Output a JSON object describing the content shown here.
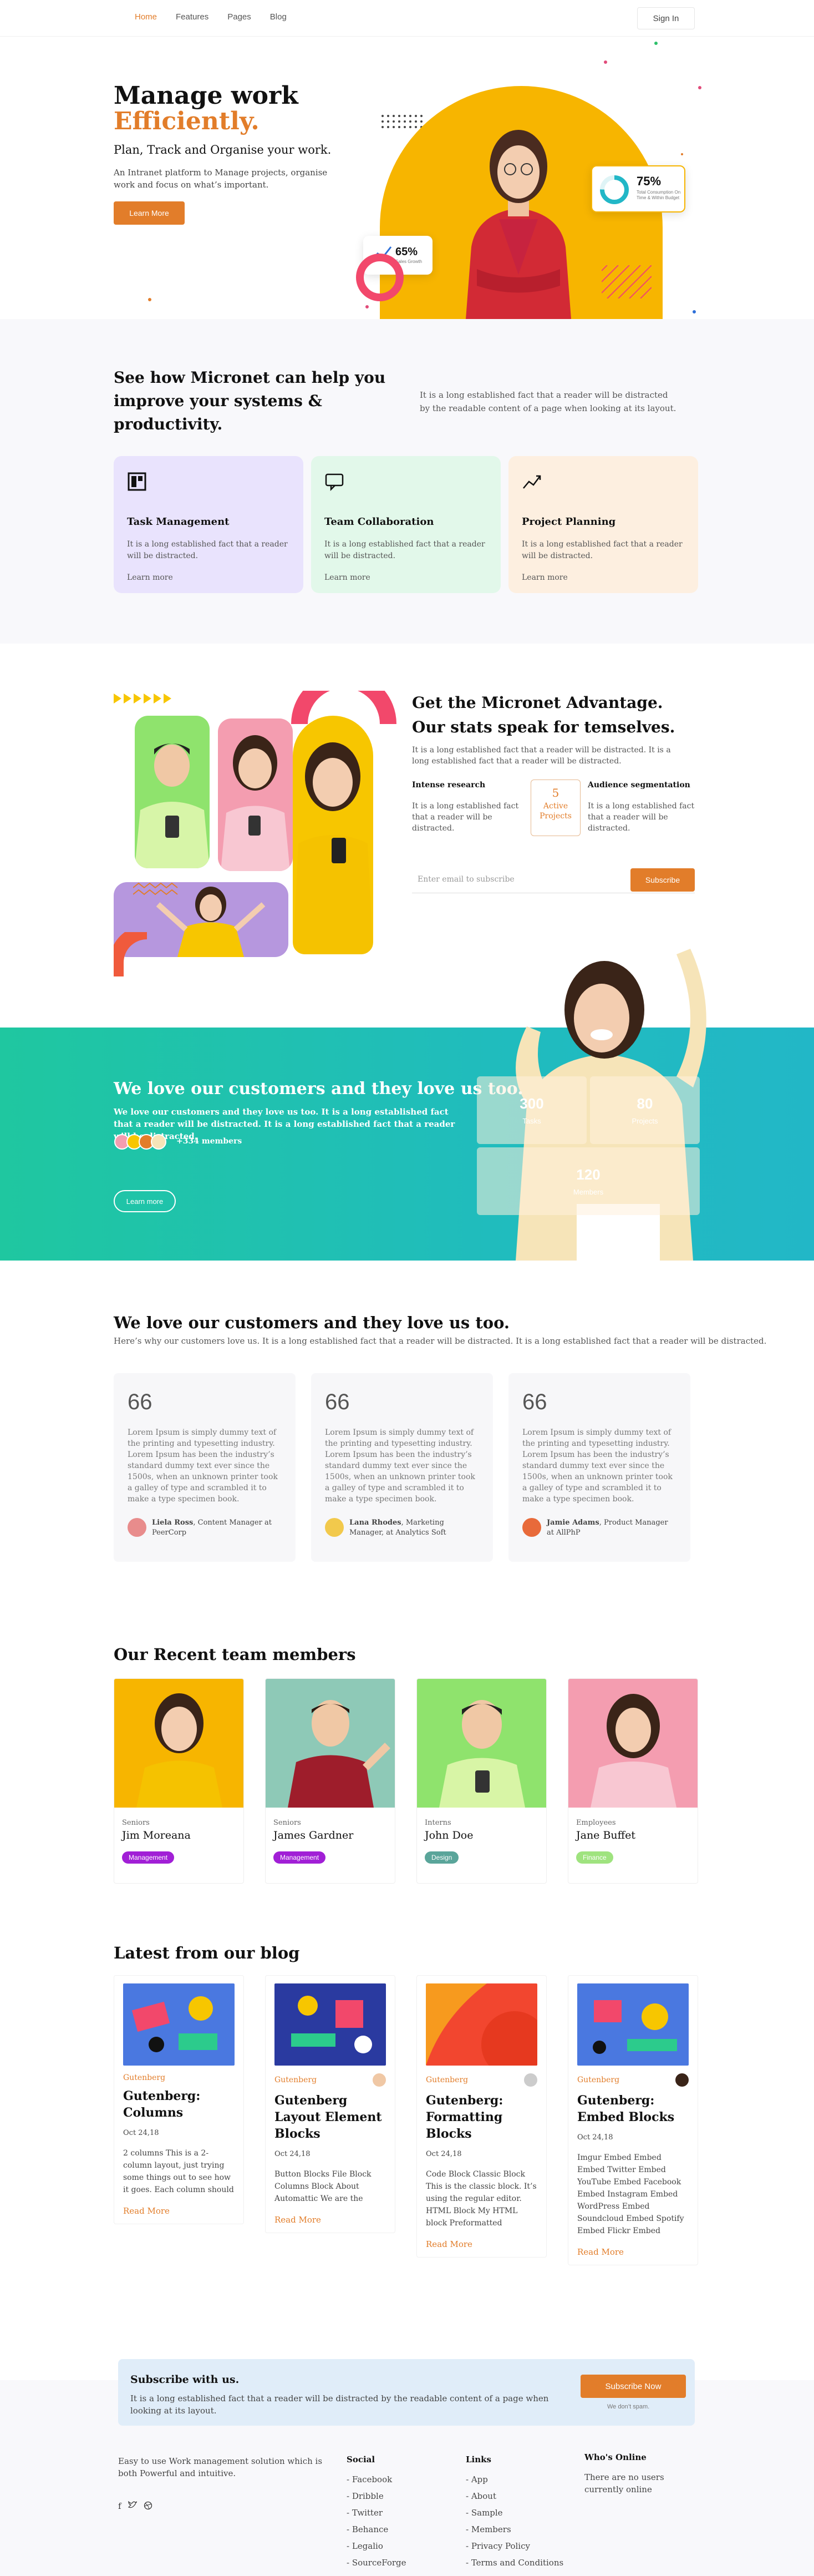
{
  "nav": {
    "items": [
      "Home",
      "Features",
      "Pages",
      "Blog"
    ],
    "signin": "Sign In"
  },
  "hero": {
    "title_line1": "Manage work",
    "title_line2": "Efficiently.",
    "subtitle": "Plan, Track and Organise your work.",
    "description": "An Intranet platform to Manage projects, organise work and focus on what’s important.",
    "button": "Learn More",
    "stat_left": "65%",
    "stat_left_caption": "Sales Growth",
    "stat_right": "75%",
    "stat_right_caption": "Total Consumption On Time & Within Budget"
  },
  "features_section": {
    "title": "See how Micronet can help you improve your systems & productivity.",
    "description": "It is a long established fact that a reader will be distracted by the readable content of a page when looking at its layout.",
    "cards": [
      {
        "title": "Task Management",
        "text": "It is a long established fact that a reader will be distracted.",
        "link": "Learn more",
        "color": "#e9e3fd",
        "icon": "layout-icon"
      },
      {
        "title": "Team Collaboration",
        "text": "It is a long established fact that a reader will be distracted.",
        "link": "Learn more",
        "color": "#e2f8ea",
        "icon": "chat-icon"
      },
      {
        "title": "Project Planning",
        "text": "It is a long established fact that a reader will be distracted.",
        "link": "Learn more",
        "color": "#fdefe0",
        "icon": "chart-line-icon"
      }
    ]
  },
  "advantage": {
    "title": "Get the Micronet Advantage. Our stats speak for temselves.",
    "description": "It is a long established fact that a reader will be distracted. It is a long established fact that a reader will be distracted.",
    "col1_title": "Intense research",
    "col1_text": "It is a long established fact that a reader will be distracted.",
    "active_number": "5",
    "active_label": "Active Projects",
    "col2_title": "Audience segmentation",
    "col2_text": "It is a long established fact that a reader will be distracted.",
    "email_placeholder": "Enter email to subscribe",
    "subscribe": "Subscribe"
  },
  "customers_banner": {
    "title": "We love our customers and they love us too.",
    "description": "We love our customers and they love us too. It is a long established fact that a reader will be distracted. It is a long established fact that a reader will be distracted.",
    "members": "+334 members",
    "button": "Learn more",
    "stats": [
      {
        "number": "300",
        "label": "Tasks"
      },
      {
        "number": "80",
        "label": "Projects"
      },
      {
        "number": "120",
        "label": "Members"
      }
    ]
  },
  "testimonials": {
    "title": "We love our customers and they love us too.",
    "description": "Here’s why our customers love us. It is a long established fact that a reader will be distracted. It is a long established fact that a reader will be distracted.",
    "quote_mark": "66",
    "items": [
      {
        "text": "Lorem Ipsum is simply dummy text of the printing and typesetting industry. Lorem Ipsum has been the industry’s standard dummy text ever since the 1500s, when an unknown printer took a galley of type and scrambled it to make a type specimen book.",
        "name": "Liela Ross",
        "role": ", Content Manager at PeerCorp",
        "avatar": "#e88c8c"
      },
      {
        "text": "Lorem Ipsum is simply dummy text of the printing and typesetting industry. Lorem Ipsum has been the industry’s standard dummy text ever since the 1500s, when an unknown printer took a galley of type and scrambled it to make a type specimen book.",
        "name": "Lana Rhodes",
        "role": ", Marketing Manager, at Analytics Soft",
        "avatar": "#f2c94c"
      },
      {
        "text": "Lorem Ipsum is simply dummy text of the printing and typesetting industry. Lorem Ipsum has been the industry’s standard dummy text ever since the 1500s, when an unknown printer took a galley of type and scrambled it to make a type specimen book.",
        "name": "Jamie Adams",
        "role": ", Product Manager at AllPhP",
        "avatar": "#e86a3a"
      }
    ]
  },
  "team": {
    "title": "Our Recent team members",
    "members": [
      {
        "role": "Seniors",
        "name": "Jim Moreana",
        "tag": "Management",
        "tag_color": "#a11fd6",
        "bg": "#f7b500",
        "shirt": "#f5c200"
      },
      {
        "role": "Seniors",
        "name": "James Gardner",
        "tag": "Management",
        "tag_color": "#a11fd6",
        "bg": "#8ec9b7",
        "shirt": "#9e1d2b"
      },
      {
        "role": "Interns",
        "name": "John Doe",
        "tag": "Design",
        "tag_color": "#5aa59a",
        "bg": "#8fe36d",
        "shirt": "#d8f5a6"
      },
      {
        "role": "Employees",
        "name": "Jane Buffet",
        "tag": "Finance",
        "tag_color": "#9fe37f",
        "bg": "#f49db0",
        "shirt": "#f8c7d2"
      }
    ]
  },
  "blog": {
    "title": "Latest from our blog",
    "posts": [
      {
        "category": "Gutenberg",
        "title": "Gutenberg: Columns",
        "date": "Oct 24,18",
        "excerpt": "2 columns This is a 2-column layout, just trying some things out to see how it goes. Each column should",
        "link": "Read More"
      },
      {
        "category": "Gutenberg",
        "title": "Gutenberg Layout Element Blocks",
        "date": "Oct 24,18",
        "excerpt": "Button Blocks File Block Columns Block About Automattic We are the",
        "link": "Read More"
      },
      {
        "category": "Gutenberg",
        "title": "Gutenberg: Formatting Blocks",
        "date": "Oct 24,18",
        "excerpt": "Code Block Classic Block This is the classic block. It’s using the regular editor. HTML Block My HTML block Preformatted",
        "link": "Read More"
      },
      {
        "category": "Gutenberg",
        "title": "Gutenberg: Embed Blocks",
        "date": "Oct 24,18",
        "excerpt": "Imgur Embed Embed Embed Twitter Embed YouTube Embed Facebook Embed Instagram Embed WordPress Embed Soundcloud Embed Spotify Embed Flickr Embed",
        "link": "Read More"
      }
    ]
  },
  "subscribe_box": {
    "title": "Subscribe with us.",
    "text": "It is a long established fact that a reader will be distracted by the readable content of a page when looking at its layout.",
    "button": "Subscribe Now",
    "note": "We don’t spam."
  },
  "footer": {
    "description": "Easy to use Work management solution which is both Powerful and intuitive.",
    "social_title": "Social",
    "social": [
      "Facebook",
      "Dribble",
      "Twitter",
      "Behance",
      "Legalio",
      "SourceForge"
    ],
    "links_title": "Links",
    "links": [
      "App",
      "About",
      "Sample",
      "Members",
      "Privacy Policy",
      "Terms and Conditions"
    ],
    "online_title": "Who's Online",
    "online_text": "There are no users currently online"
  },
  "colors": {
    "accent": "#e27d2a",
    "teal": "#20bcbd",
    "yellow": "#f7b500"
  }
}
